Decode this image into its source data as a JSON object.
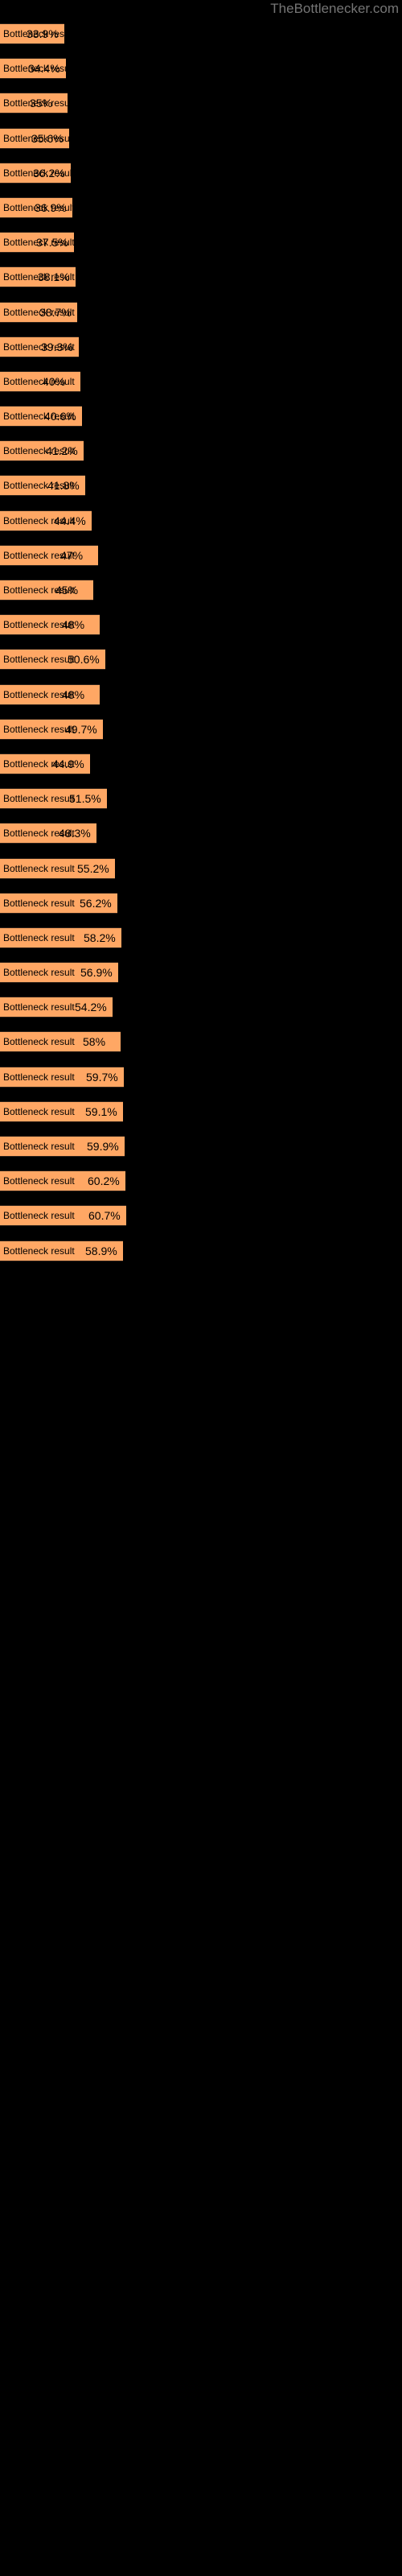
{
  "site": {
    "title": "TheBottlenecker.com",
    "title_color": "#757575"
  },
  "theme": {
    "background": "#000000",
    "bar_fill": "#ffa764",
    "bar_border": "#2d2118",
    "text_color": "#000000"
  },
  "chart_data": {
    "type": "bar",
    "orientation": "horizontal",
    "title": "",
    "subtitle": "",
    "xlabel": "",
    "ylabel": "",
    "grid": false,
    "legend": null,
    "xlim": [
      0,
      100
    ],
    "bar_label_text": "Bottleneck result",
    "value_suffix": "%",
    "note": "Each bar is labelled 'Bottleneck result' on the left; the percentage value is drawn near the right end of the bar and is clipped where the bar ends.",
    "categories": [
      "Bottleneck result",
      "Bottleneck result",
      "Bottleneck result",
      "Bottleneck result",
      "Bottleneck result",
      "Bottleneck result",
      "Bottleneck result",
      "Bottleneck result",
      "Bottleneck result",
      "Bottleneck result",
      "Bottleneck result",
      "Bottleneck result",
      "Bottleneck result",
      "Bottleneck result",
      "Bottleneck result",
      "Bottleneck result",
      "Bottleneck result",
      "Bottleneck result",
      "Bottleneck result",
      "Bottleneck result",
      "Bottleneck result",
      "Bottleneck result",
      "Bottleneck result",
      "Bottleneck result",
      "Bottleneck result",
      "Bottleneck result",
      "Bottleneck result",
      "Bottleneck result",
      "Bottleneck result",
      "Bottleneck result",
      "Bottleneck result",
      "Bottleneck result",
      "Bottleneck result",
      "Bottleneck result",
      "Bottleneck result",
      "Bottleneck result"
    ],
    "values": [
      33.9,
      34.4,
      35.0,
      35.6,
      36.2,
      36.9,
      37.5,
      38.1,
      38.7,
      39.3,
      40.0,
      40.6,
      41.2,
      41.8,
      44.4,
      47.0,
      45.0,
      48.0,
      50.6,
      48.0,
      49.7,
      44.9,
      51.5,
      48.3,
      55.2,
      56.2,
      58.2,
      56.9,
      54.2,
      58.0,
      59.7,
      59.1,
      59.9,
      60.2,
      60.7,
      58.9
    ],
    "value_labels": [
      "",
      "",
      "",
      "",
      "",
      "",
      "",
      "",
      "",
      "",
      "",
      "",
      "",
      "",
      "",
      "4",
      "",
      "4",
      "50",
      "4",
      "49",
      "",
      "51.",
      "4",
      "55.2%",
      "56.2%",
      "58.2%",
      "56.9%",
      "54.2",
      "58%",
      "59.7%",
      "59.1%",
      "59.9%",
      "60.2%",
      "60.7%",
      "58.9%"
    ],
    "full_values": [
      "33.9%",
      "34.4%",
      "35%",
      "35.6%",
      "36.2%",
      "36.9%",
      "37.5%",
      "38.1%",
      "38.7%",
      "39.3%",
      "40%",
      "40.6%",
      "41.2%",
      "41.8%",
      "44.4%",
      "47%",
      "45%",
      "48%",
      "50.6%",
      "48%",
      "49.7%",
      "44.9%",
      "51.5%",
      "48.3%",
      "55.2%",
      "56.2%",
      "58.2%",
      "56.9%",
      "54.2%",
      "58%",
      "59.7%",
      "59.1%",
      "59.9%",
      "60.2%",
      "60.7%",
      "58.9%"
    ],
    "bar_pixel_widths": [
      80,
      82,
      84,
      86,
      88,
      90,
      92,
      94,
      96,
      98,
      100,
      102,
      104,
      106,
      114,
      122,
      116,
      124,
      131,
      124,
      128,
      112,
      133,
      120,
      143,
      146,
      151,
      147,
      140,
      150,
      154,
      153,
      155,
      156,
      157,
      153
    ]
  }
}
